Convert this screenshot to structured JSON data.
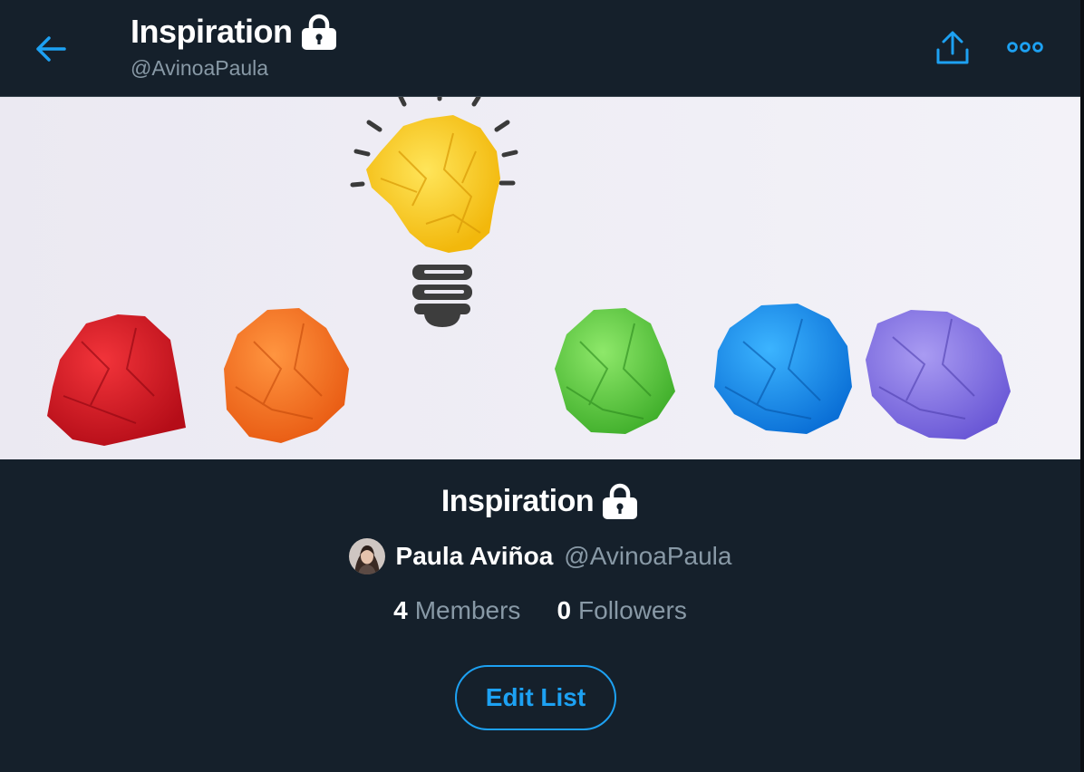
{
  "header": {
    "title": "Inspiration",
    "handle": "@AvinoaPaula",
    "back_icon": "arrow-left-icon",
    "share_icon": "share-icon",
    "more_icon": "more-horizontal-icon",
    "lock_icon": "lock-icon"
  },
  "list": {
    "title": "Inspiration",
    "owner_name": "Paula Aviñoa",
    "owner_handle": "@AvinoaPaula",
    "members_count": "4",
    "members_label": "Members",
    "followers_count": "0",
    "followers_label": "Followers",
    "edit_button_label": "Edit List"
  },
  "colors": {
    "background": "#15202b",
    "accent": "#1da1f2",
    "secondary_text": "#8899a6",
    "primary_text": "#ffffff"
  }
}
